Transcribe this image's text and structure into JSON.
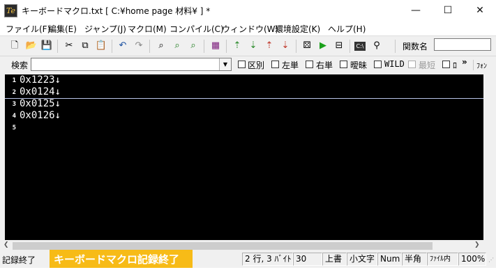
{
  "window": {
    "app_icon_text": "Te",
    "title": "キーボードマクロ.txt [ C:¥home page 材料¥ ] *",
    "minimize": "—",
    "maximize": "☐",
    "close": "✕"
  },
  "menu": [
    "ファイル(F)",
    "編集(E)",
    "ジャンプ(J)",
    "マクロ(M)",
    "コンパイル(C)",
    "ウィンドウ(W)",
    "環境設定(K)",
    "ヘルプ(H)"
  ],
  "toolbar": {
    "function_label": "関数名",
    "function_value": ""
  },
  "search": {
    "label": "検索",
    "value": "",
    "options": [
      "区別",
      "左単",
      "右単",
      "曖昧",
      "WILD",
      "最短",
      "ﾛ"
    ],
    "overflow": "»",
    "font_button": "ﾌｫﾝ"
  },
  "editor": {
    "line_numbers": [
      "1",
      "2",
      "3",
      "4",
      "5"
    ],
    "lines": [
      "0x1223↓",
      "0x0124↓",
      "0x0125↓",
      "0x0126↓",
      ""
    ]
  },
  "status": {
    "message": "記録終了",
    "position": "2 行, 3 ﾊﾞｲﾄ",
    "column": "30",
    "mode": "上書",
    "case": "小文字",
    "numlock": "Num",
    "width": "半角",
    "location": "ﾌｧｲﾙ内",
    "zoom": "100%"
  },
  "toast": "キーボードマクロ記録終了"
}
